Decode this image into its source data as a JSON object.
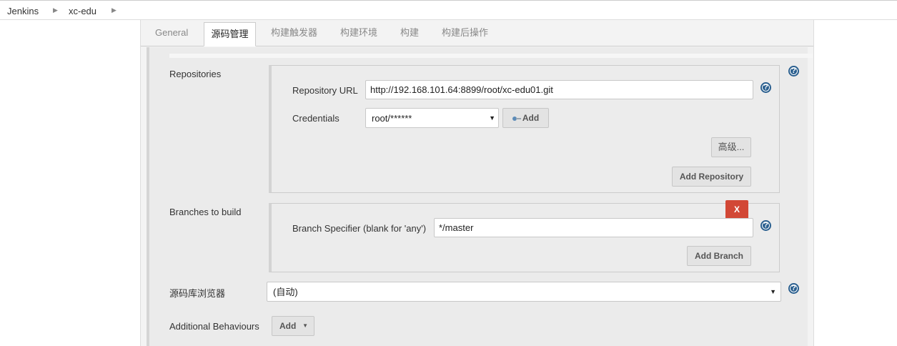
{
  "breadcrumb": {
    "items": [
      "Jenkins",
      "xc-edu"
    ]
  },
  "tabs": [
    {
      "label": "General"
    },
    {
      "label": "源码管理"
    },
    {
      "label": "构建触发器"
    },
    {
      "label": "构建环境"
    },
    {
      "label": "构建"
    },
    {
      "label": "构建后操作"
    }
  ],
  "repositories": {
    "section_label": "Repositories",
    "url_label": "Repository URL",
    "url_value": "http://192.168.101.64:8899/root/xc-edu01.git",
    "credentials_label": "Credentials",
    "credentials_value": "root/******",
    "add_label": "Add",
    "advanced_label": "高级...",
    "add_repository_label": "Add Repository"
  },
  "branches": {
    "section_label": "Branches to build",
    "delete_label": "X",
    "specifier_label": "Branch Specifier (blank for 'any')",
    "specifier_value": "*/master",
    "add_branch_label": "Add Branch"
  },
  "browser": {
    "label": "源码库浏览器",
    "value": "(自动)"
  },
  "behaviours": {
    "label": "Additional Behaviours",
    "add_label": "Add"
  },
  "help_glyph": "?",
  "colors": {
    "delete_button": "#d24836",
    "help_icon": "#2a5f8f"
  }
}
